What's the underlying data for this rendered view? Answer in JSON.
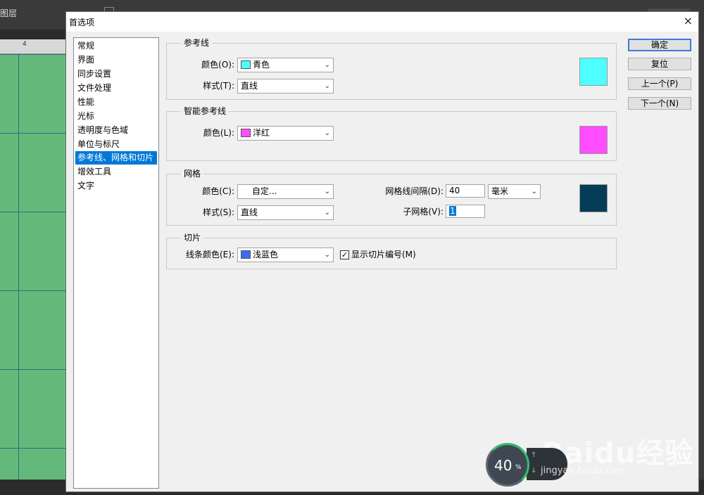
{
  "background": {
    "layers_label": "图层",
    "ruler_number": "4"
  },
  "dialog": {
    "title": "首选项",
    "close_label": "×"
  },
  "nav": {
    "items": [
      {
        "label": "常规"
      },
      {
        "label": "界面"
      },
      {
        "label": "同步设置"
      },
      {
        "label": "文件处理"
      },
      {
        "label": "性能"
      },
      {
        "label": "光标"
      },
      {
        "label": "透明度与色域"
      },
      {
        "label": "单位与标尺"
      },
      {
        "label": "参考线、网格和切片"
      },
      {
        "label": "增效工具"
      },
      {
        "label": "文字"
      }
    ],
    "selected_index": 8
  },
  "guides": {
    "group_label": "参考线",
    "color_label": "颜色(O):",
    "color_value": "青色",
    "color_swatch": "#4dffff",
    "style_label": "样式(T):",
    "style_value": "直线"
  },
  "smart_guides": {
    "group_label": "智能参考线",
    "color_label": "颜色(L):",
    "color_value": "洋红",
    "color_swatch": "#ff4dff"
  },
  "grid": {
    "group_label": "网格",
    "color_label": "颜色(C):",
    "color_value": "自定...",
    "color_swatch": "#053c57",
    "style_label": "样式(S):",
    "style_value": "直线",
    "spacing_label": "网格线间隔(D):",
    "spacing_value": "40",
    "unit_value": "毫米",
    "subdiv_label": "子网格(V):",
    "subdiv_value": "1"
  },
  "slices": {
    "group_label": "切片",
    "line_color_label": "线条颜色(E):",
    "line_color_value": "浅蓝色",
    "line_color_swatch": "#3b6cf5",
    "show_numbers_label": "显示切片编号(M)",
    "show_numbers_checked": true
  },
  "buttons": {
    "ok": "确定",
    "reset": "复位",
    "prev": "上一个(P)",
    "next": "下一个(N)"
  },
  "watermark": {
    "badge_value": "40",
    "badge_unit": "%",
    "logo": "Baidu经验",
    "url": "jingyan.baidu.com"
  }
}
